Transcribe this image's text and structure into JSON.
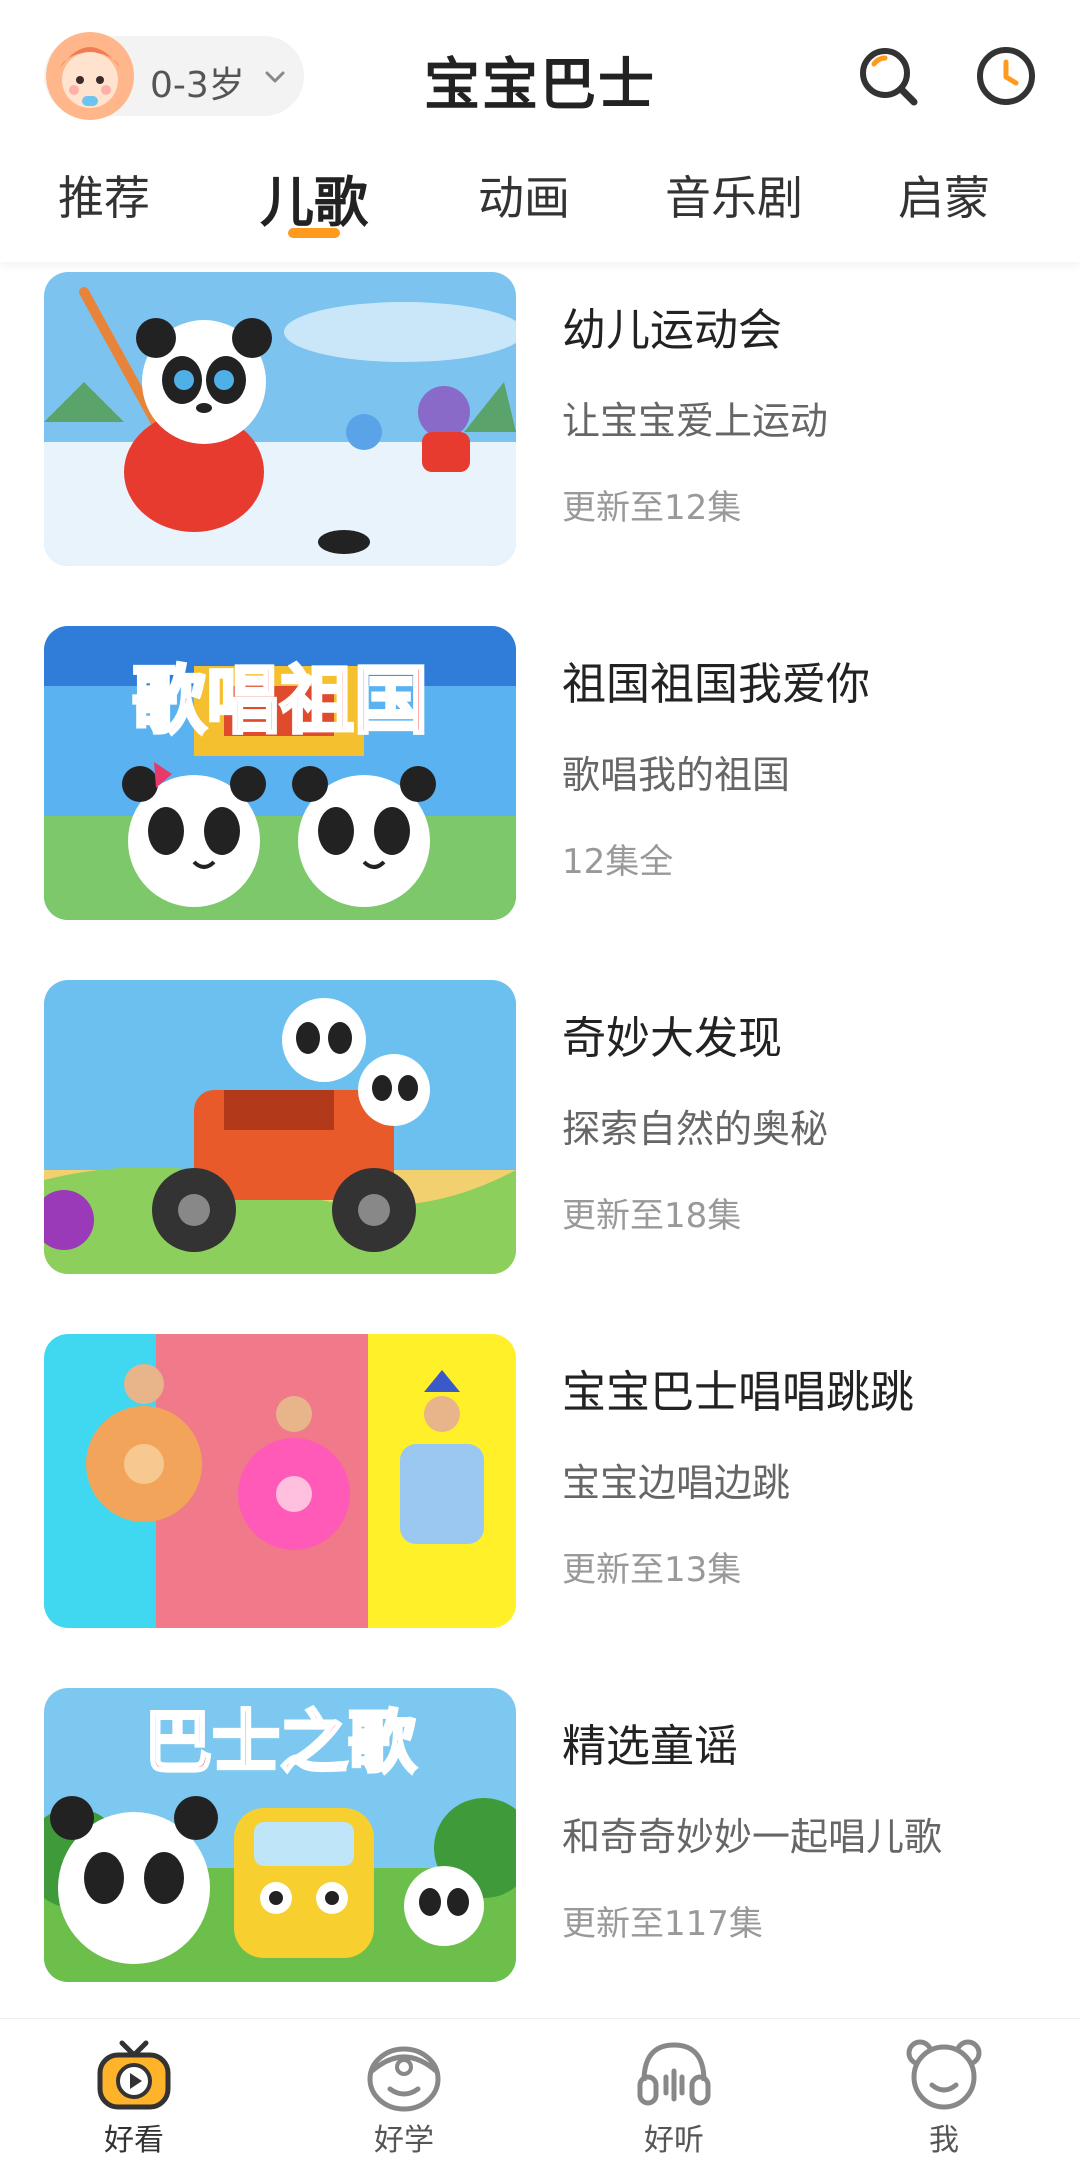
{
  "header": {
    "age_selector": "0-3岁",
    "title": "宝宝巴士",
    "icons": [
      "search-icon",
      "history-clock-icon"
    ]
  },
  "tabs": [
    {
      "label": "推荐",
      "active": false
    },
    {
      "label": "儿歌",
      "active": true
    },
    {
      "label": "动画",
      "active": false
    },
    {
      "label": "音乐剧",
      "active": false
    },
    {
      "label": "启蒙",
      "active": false
    }
  ],
  "colors": {
    "accent": "#ff9a1f",
    "text_primary": "#222222",
    "text_secondary": "#666666",
    "text_meta": "#999999"
  },
  "list": [
    {
      "title": "幼儿运动会",
      "subtitle": "让宝宝爱上运动",
      "meta": "更新至12集",
      "thumbnail": "panda-ice-hockey"
    },
    {
      "title": "祖国祖国我爱你",
      "subtitle": "歌唱我的祖国",
      "meta": "12集全",
      "thumbnail": "two-pandas-歌唱祖国"
    },
    {
      "title": "奇妙大发现",
      "subtitle": "探索自然的奥秘",
      "meta": "更新至18集",
      "thumbnail": "pandas-in-truck"
    },
    {
      "title": "宝宝巴士唱唱跳跳",
      "subtitle": "宝宝边唱边跳",
      "meta": "更新至13集",
      "thumbnail": "kids-in-donut-costumes"
    },
    {
      "title": "精选童谣",
      "subtitle": "和奇奇妙妙一起唱儿歌",
      "meta": "更新至117集",
      "thumbnail": "pandas-with-yellow-bus-巴士之歌"
    }
  ],
  "thumbnail_text": {
    "item2": "歌唱祖国",
    "item5": "巴士之歌"
  },
  "bottom_nav": [
    {
      "label": "好看",
      "icon": "tv-play-icon",
      "active": true
    },
    {
      "label": "好学",
      "icon": "learn-face-icon",
      "active": false
    },
    {
      "label": "好听",
      "icon": "headphones-icon",
      "active": false
    },
    {
      "label": "我",
      "icon": "bear-face-icon",
      "active": false
    }
  ]
}
